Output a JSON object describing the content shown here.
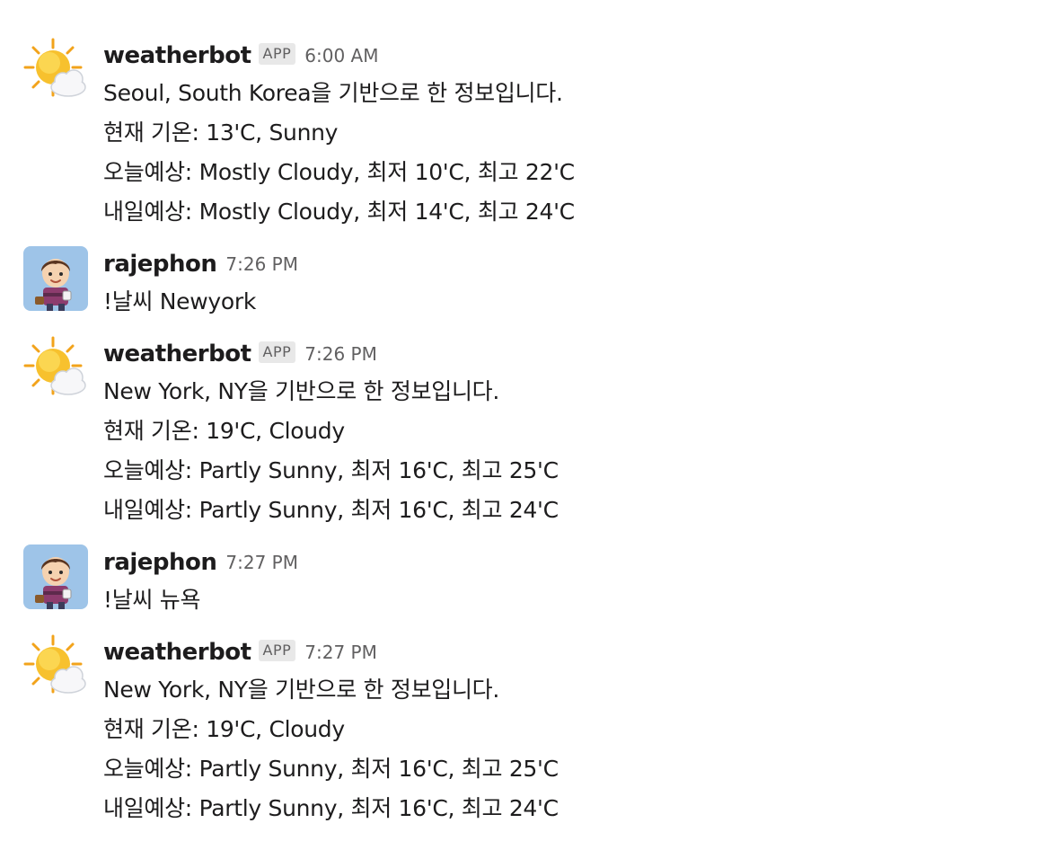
{
  "messages": [
    {
      "user": "weatherbot",
      "badge": "APP",
      "time": "6:00 AM",
      "avatar": "sun-cloud-avatar",
      "lines": [
        "Seoul, South Korea을 기반으로 한 정보입니다.",
        "현재 기온: 13'C, Sunny",
        "오늘예상: Mostly Cloudy, 최저 10'C, 최고 22'C",
        "내일예상: Mostly Cloudy, 최저 14'C, 최고 24'C"
      ]
    },
    {
      "user": "rajephon",
      "time": "7:26 PM",
      "avatar": "person-avatar",
      "lines": [
        "!날씨 Newyork"
      ]
    },
    {
      "user": "weatherbot",
      "badge": "APP",
      "time": "7:26 PM",
      "avatar": "sun-cloud-avatar",
      "lines": [
        "New York, NY을 기반으로 한 정보입니다.",
        "현재 기온: 19'C, Cloudy",
        "오늘예상: Partly Sunny, 최저 16'C, 최고 25'C",
        "내일예상: Partly Sunny, 최저 16'C, 최고 24'C"
      ]
    },
    {
      "user": "rajephon",
      "time": "7:27 PM",
      "avatar": "person-avatar",
      "lines": [
        "!날씨 뉴욕"
      ]
    },
    {
      "user": "weatherbot",
      "badge": "APP",
      "time": "7:27 PM",
      "avatar": "sun-cloud-avatar",
      "lines": [
        "New York, NY을 기반으로 한 정보입니다.",
        "현재 기온: 19'C, Cloudy",
        "오늘예상: Partly Sunny, 최저 16'C, 최고 25'C",
        "내일예상: Partly Sunny, 최저 16'C, 최고 24'C"
      ]
    }
  ],
  "colors": {
    "text": "#1d1c1d",
    "muted": "#616061",
    "badge_bg": "#e8e8e8",
    "avatar_bg": "#9ec4e8",
    "sun": "#f7c12e"
  }
}
